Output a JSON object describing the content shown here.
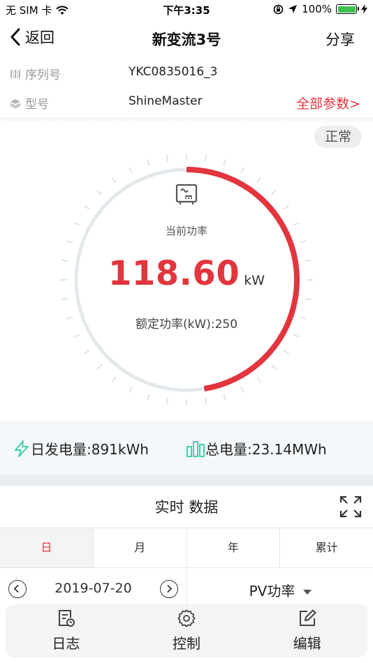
{
  "status_bar": {
    "carrier": "无 SIM 卡",
    "time": "下午3:35",
    "battery": "100%"
  },
  "nav": {
    "back_label": "返回",
    "title": "新变流3号",
    "share_label": "分享"
  },
  "info": {
    "serial_label": "序列号",
    "serial_value": "YKC0835016_3",
    "model_label": "型号",
    "model_value": "ShineMaster",
    "all_params_label": "全部参数>"
  },
  "status_badge": "正常",
  "gauge": {
    "label": "当前功率",
    "value": "118.60",
    "unit": "kW",
    "rated_text": "额定功率(kW):250",
    "current_power_kw": 118.6,
    "rated_power_kw": 250
  },
  "energy": {
    "daily_text": "日发电量:891kWh",
    "total_text": "总电量:23.14MWh"
  },
  "section": {
    "title": "实时 数据"
  },
  "tabs": [
    "日",
    "月",
    "年",
    "累计"
  ],
  "date_row": {
    "date": "2019-07-20",
    "selector": "PV功率"
  },
  "bottom_bar": {
    "log_label": "日志",
    "control_label": "控制",
    "edit_label": "编辑"
  },
  "colors": {
    "accent": "#e2353d",
    "gauge_track": "#e3e8ec",
    "tick": "#dde3f0",
    "energy_icon": "#3dd2b0"
  }
}
